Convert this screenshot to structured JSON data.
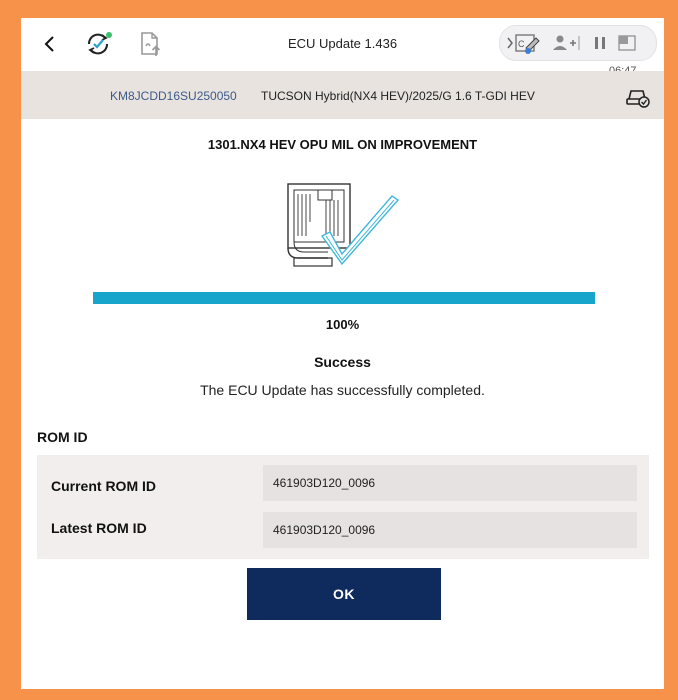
{
  "header": {
    "title": "ECU Update 1.436",
    "clock": "06:47",
    "icons": [
      "back-icon",
      "sync-check-icon",
      "document-upload-icon",
      "screenshot-edit-icon",
      "add-user-icon",
      "pause-icon",
      "window-icon"
    ]
  },
  "vehicle": {
    "vin": "KM8JCDD16SU250050",
    "model": "TUCSON Hybrid(NX4 HEV)/2025/G 1.6 T-GDI HEV"
  },
  "main": {
    "heading": "1301.NX4 HEV OPU MIL ON IMPROVEMENT",
    "progress_percent": 100,
    "progress_text": "100%",
    "status_title": "Success",
    "status_message": "The ECU Update has successfully completed."
  },
  "rom": {
    "section_label": "ROM ID",
    "rows": [
      {
        "label": "Current ROM ID",
        "value": "461903D120_0096"
      },
      {
        "label": "Latest ROM ID",
        "value": "461903D120_0096"
      }
    ]
  },
  "actions": {
    "ok_label": "OK"
  },
  "colors": {
    "outer_frame": "#f6924a",
    "progress": "#18a5cc",
    "button": "#0f2a5c",
    "vin_text": "#3d5a8a",
    "check_accent": "#3fb8d8"
  }
}
